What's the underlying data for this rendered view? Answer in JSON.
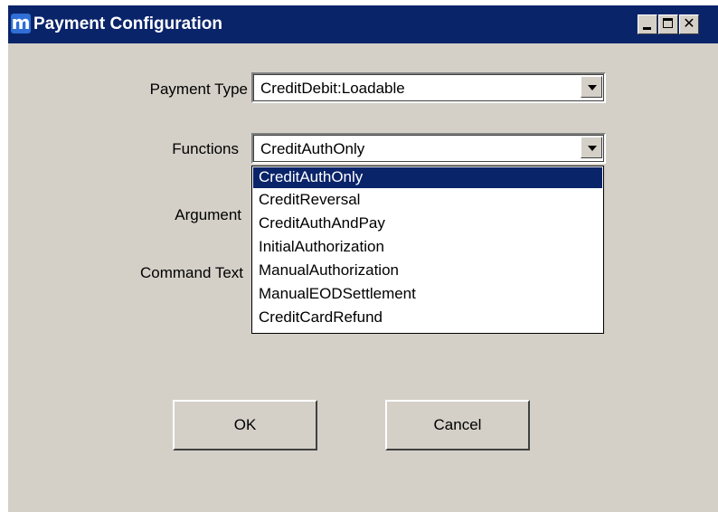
{
  "window": {
    "title": "Payment Configuration",
    "app_icon_letter": "m",
    "title_color": "#0a246a"
  },
  "form": {
    "payment_type_label": "Payment Type",
    "payment_type_value": "CreditDebit:Loadable",
    "functions_label": "Functions",
    "functions_value": "CreditAuthOnly",
    "argument_label": "Argument",
    "command_text_label": "Command Text"
  },
  "functions_dropdown": {
    "selected_index": 0,
    "options": [
      "CreditAuthOnly",
      "CreditReversal",
      "CreditAuthAndPay",
      "InitialAuthorization",
      "ManualAuthorization",
      "ManualEODSettlement",
      "CreditCardRefund"
    ]
  },
  "buttons": {
    "ok_label": "OK",
    "cancel_label": "Cancel"
  }
}
